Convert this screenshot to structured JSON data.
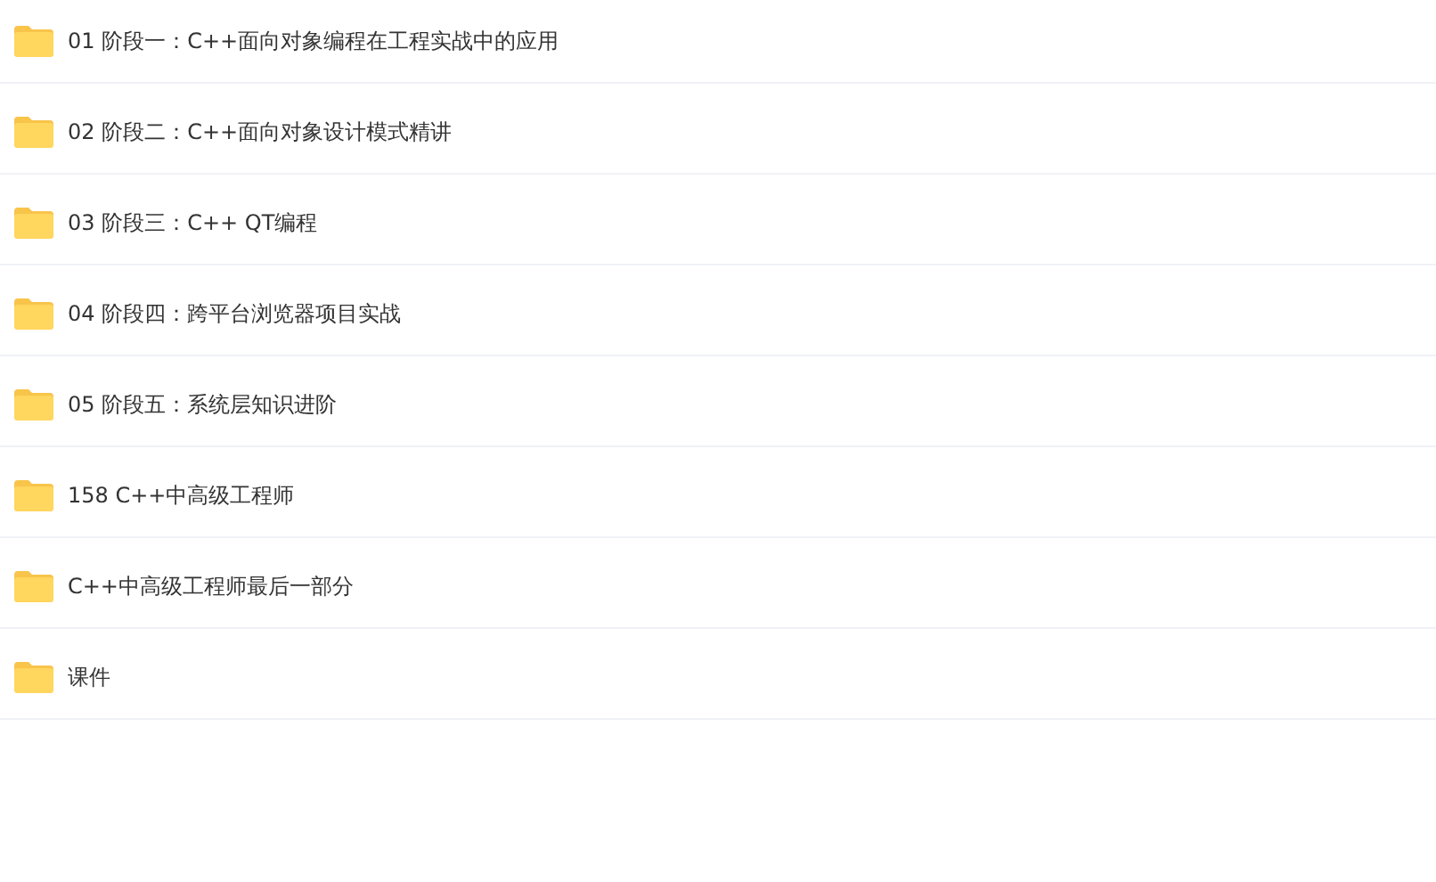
{
  "folders": [
    {
      "name": "01 阶段一：C++面向对象编程在工程实战中的应用"
    },
    {
      "name": "02 阶段二：C++面向对象设计模式精讲"
    },
    {
      "name": "03 阶段三：C++ QT编程"
    },
    {
      "name": "04 阶段四：跨平台浏览器项目实战"
    },
    {
      "name": "05 阶段五：系统层知识进阶"
    },
    {
      "name": "158 C++中高级工程师"
    },
    {
      "name": "C++中高级工程师最后一部分"
    },
    {
      "name": "课件"
    }
  ]
}
